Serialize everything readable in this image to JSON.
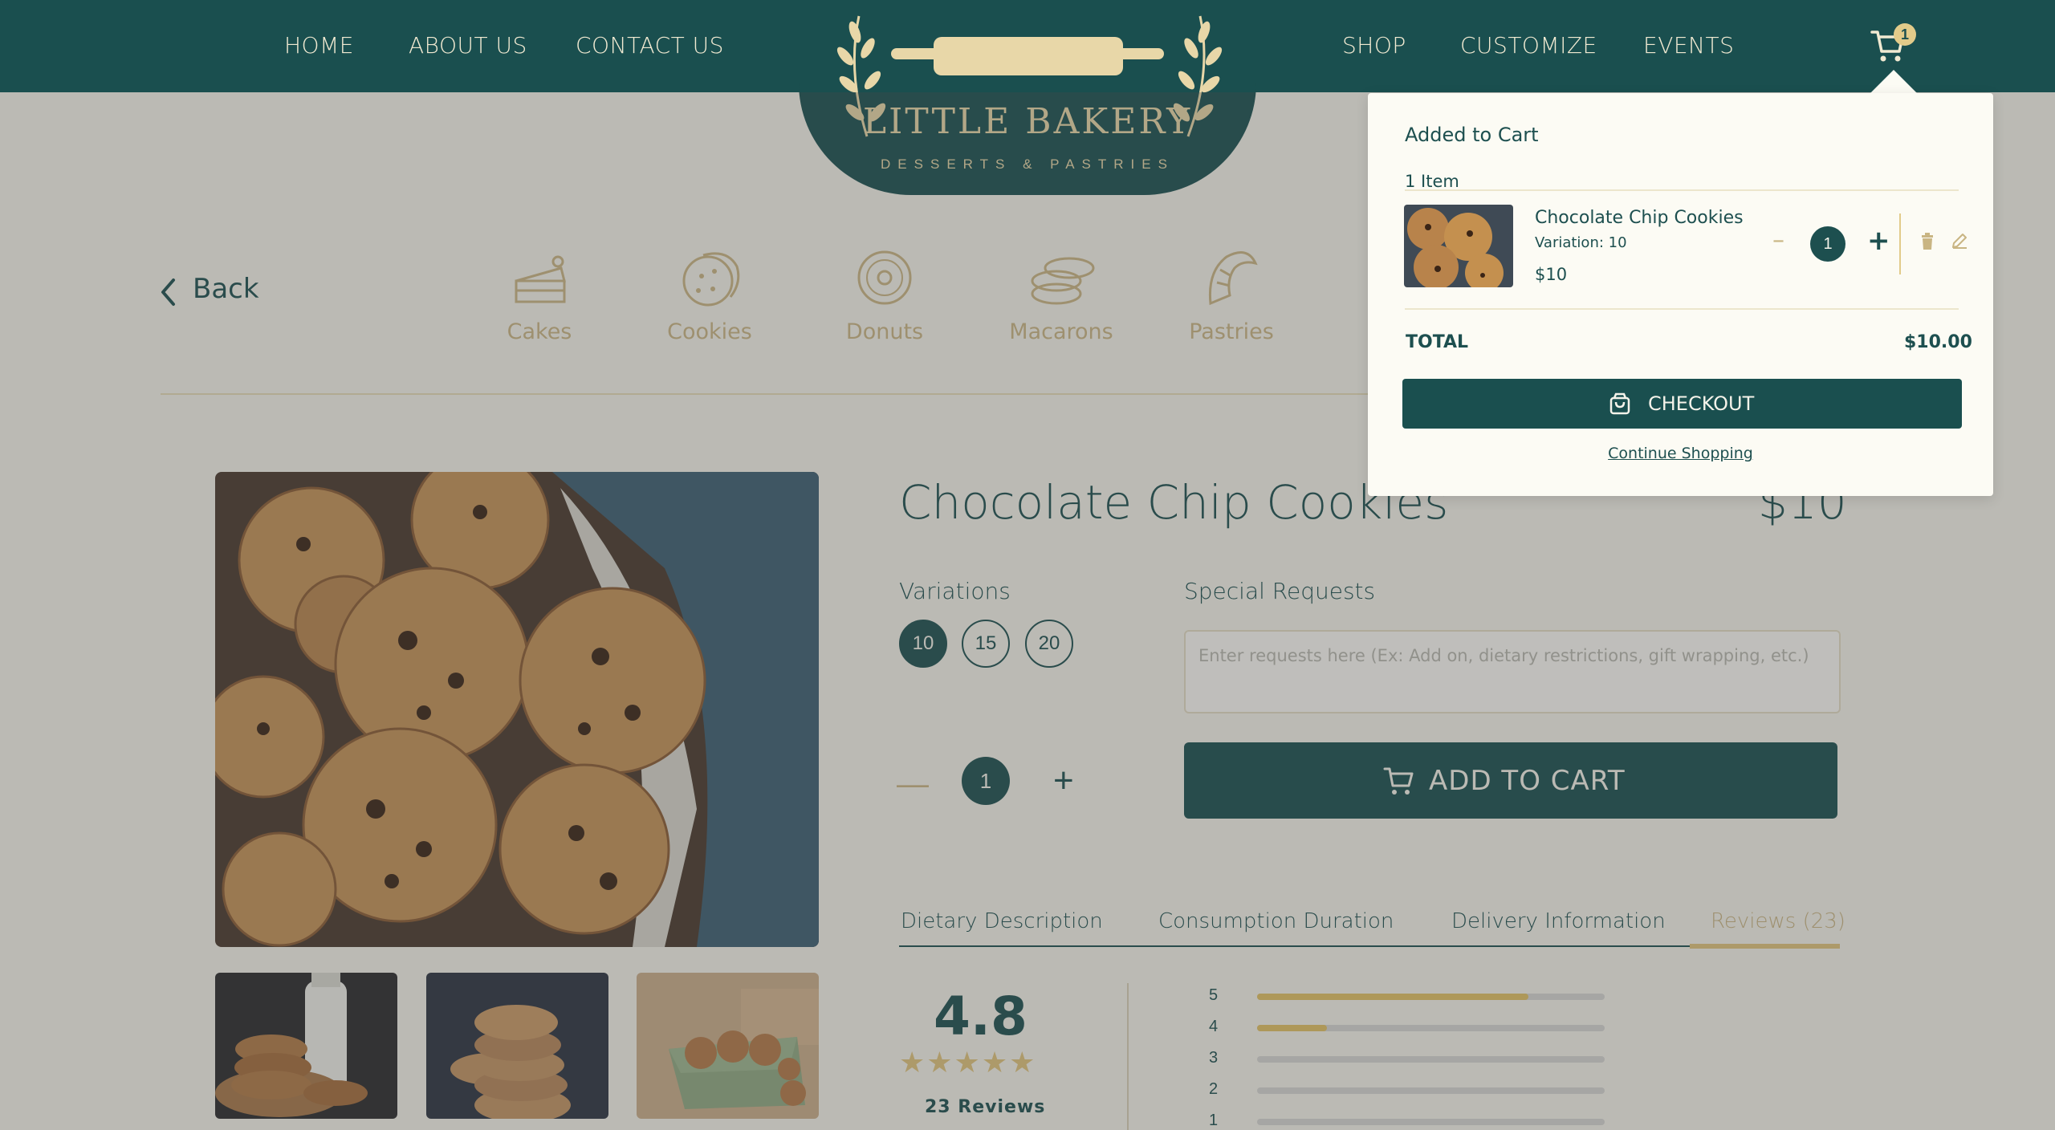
{
  "nav": {
    "links_left": [
      "HOME",
      "ABOUT US",
      "CONTACT US"
    ],
    "links_right": [
      "SHOP",
      "CUSTOMIZE",
      "EVENTS"
    ],
    "cart_count": "1",
    "logo_title": "LITTLE BAKERY",
    "logo_subtitle": "DESSERTS & PASTRIES"
  },
  "back_label": "Back",
  "categories": [
    {
      "label": "Cakes",
      "icon": "cake-icon"
    },
    {
      "label": "Cookies",
      "icon": "cookie-icon"
    },
    {
      "label": "Donuts",
      "icon": "donut-icon"
    },
    {
      "label": "Macarons",
      "icon": "macaron-icon"
    },
    {
      "label": "Pastries",
      "icon": "croissant-icon"
    }
  ],
  "product": {
    "title": "Chocolate Chip Cookies",
    "price": "$10",
    "variations_label": "Variations",
    "variations": [
      "10",
      "15",
      "20"
    ],
    "selected_variation": "10",
    "special_requests_label": "Special Requests",
    "special_requests_placeholder": "Enter requests here (Ex: Add on, dietary restrictions, gift wrapping, etc.)",
    "quantity": "1",
    "add_to_cart_label": "ADD TO CART"
  },
  "tabs": [
    "Dietary Description",
    "Consumption Duration",
    "Delivery Information",
    "Reviews (23)"
  ],
  "active_tab": "Reviews (23)",
  "reviews": {
    "average": "4.8",
    "count_label": "23 Reviews",
    "stars": "★★★★★",
    "distribution": [
      {
        "stars": "5",
        "fraction": 0.78
      },
      {
        "stars": "4",
        "fraction": 0.2
      },
      {
        "stars": "3",
        "fraction": 0
      },
      {
        "stars": "2",
        "fraction": 0
      },
      {
        "stars": "1",
        "fraction": 0
      }
    ]
  },
  "cart_popup": {
    "title": "Added to Cart",
    "item_count": "1 Item",
    "item": {
      "name": "Chocolate Chip Cookies",
      "variation": "Variation: 10",
      "price": "$10",
      "quantity": "1"
    },
    "total_label": "TOTAL",
    "total_value": "$10.00",
    "checkout_label": "CHECKOUT",
    "continue_label": "Continue Shopping"
  },
  "colors": {
    "primary": "#1a4f4f",
    "accent": "#e2c063",
    "background": "#f5f3ea"
  }
}
